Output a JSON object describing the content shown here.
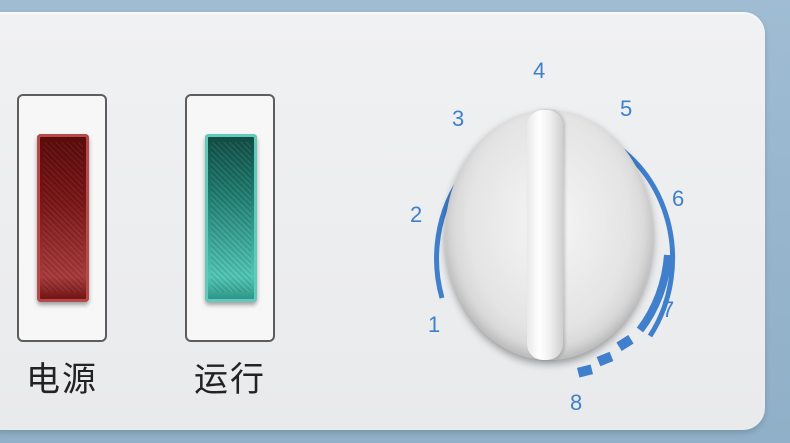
{
  "switches": [
    {
      "label": "电源",
      "color": "#8a1c1c"
    },
    {
      "label": "运行",
      "color": "#2fa695"
    }
  ],
  "dial": {
    "numbers": [
      "1",
      "2",
      "3",
      "4",
      "5",
      "6",
      "7",
      "8"
    ],
    "accent_color": "#3f7fcc"
  }
}
